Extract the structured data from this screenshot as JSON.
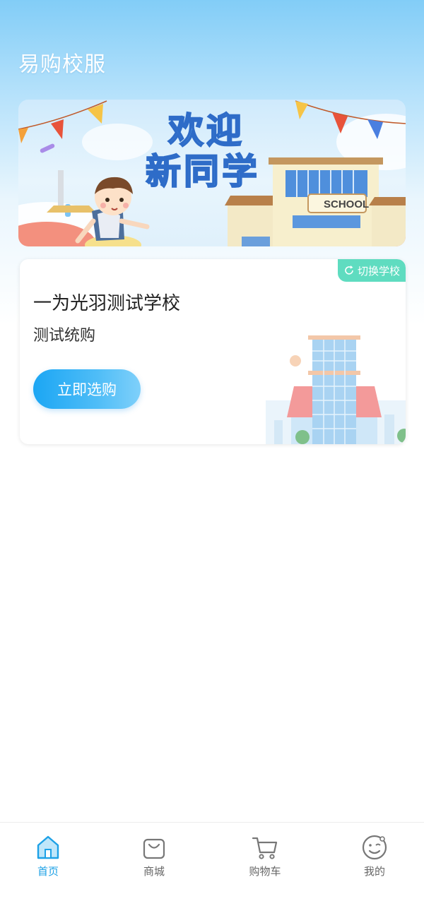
{
  "header": {
    "title": "易购校服"
  },
  "banner": {
    "line1": "欢迎",
    "line2": "新同学",
    "school_sign": "SCHOOL"
  },
  "school_card": {
    "switch_label": "切换学校",
    "school_name": "一为光羽测试学校",
    "purchase_name": "测试统购",
    "buy_button": "立即选购"
  },
  "tabbar": {
    "items": [
      {
        "label": "首页",
        "icon": "home-icon",
        "active": true
      },
      {
        "label": "商城",
        "icon": "shopping-bag-icon",
        "active": false
      },
      {
        "label": "购物车",
        "icon": "cart-icon",
        "active": false
      },
      {
        "label": "我的",
        "icon": "profile-face-icon",
        "active": false
      }
    ]
  },
  "colors": {
    "accent": "#1da1e6",
    "switch_badge": "#5fdcc0",
    "header_gradient_top": "#82cdf7"
  }
}
